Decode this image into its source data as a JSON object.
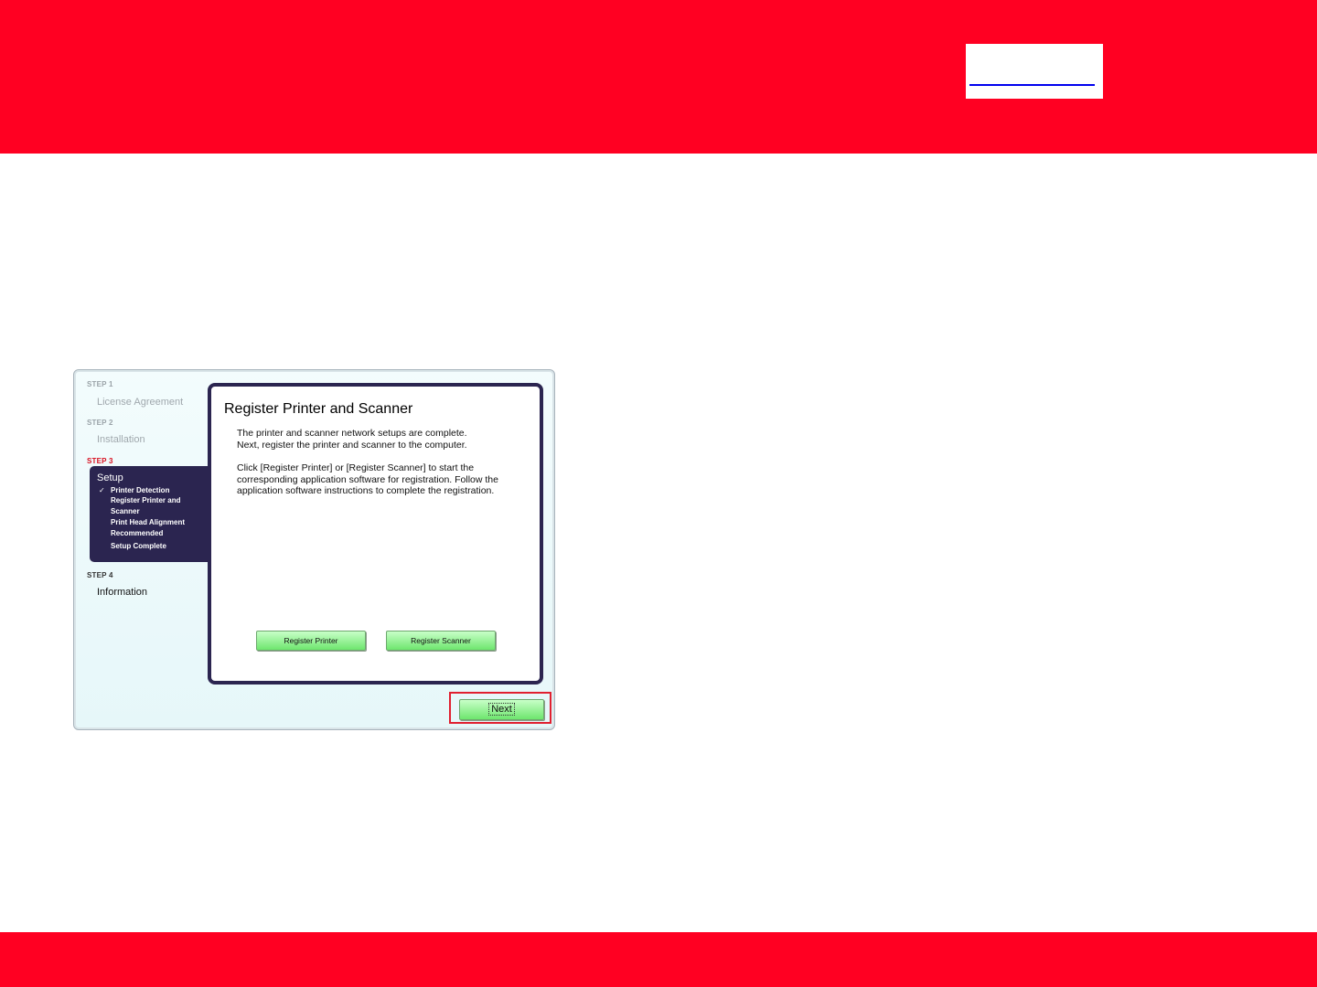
{
  "sidebar": {
    "step1_label": "STEP 1",
    "step1_title": "License Agreement",
    "step2_label": "STEP 2",
    "step2_title": "Installation",
    "step3_label": "STEP 3",
    "step3_title": "Setup",
    "step3_items": [
      "Printer Detection",
      "Register Printer and Scanner",
      "Print Head Alignment Recommended",
      "Setup Complete"
    ],
    "step3_check": "✓",
    "step4_label": "STEP 4",
    "step4_title": "Information"
  },
  "panel": {
    "title": "Register Printer and Scanner",
    "para1_line1": "The printer and scanner network setups are complete.",
    "para1_line2": "Next, register the printer and scanner to the computer.",
    "para2": "Click [Register Printer] or [Register Scanner] to start the corresponding application software for registration. Follow the application software instructions to complete the registration.",
    "register_printer": "Register Printer",
    "register_scanner": "Register Scanner"
  },
  "footer": {
    "next_label": "Next"
  },
  "colors": {
    "brand_red": "#ff0022",
    "panel_border": "#2b2550",
    "button_green": "#6ee66e",
    "highlight_red": "#e02030"
  }
}
